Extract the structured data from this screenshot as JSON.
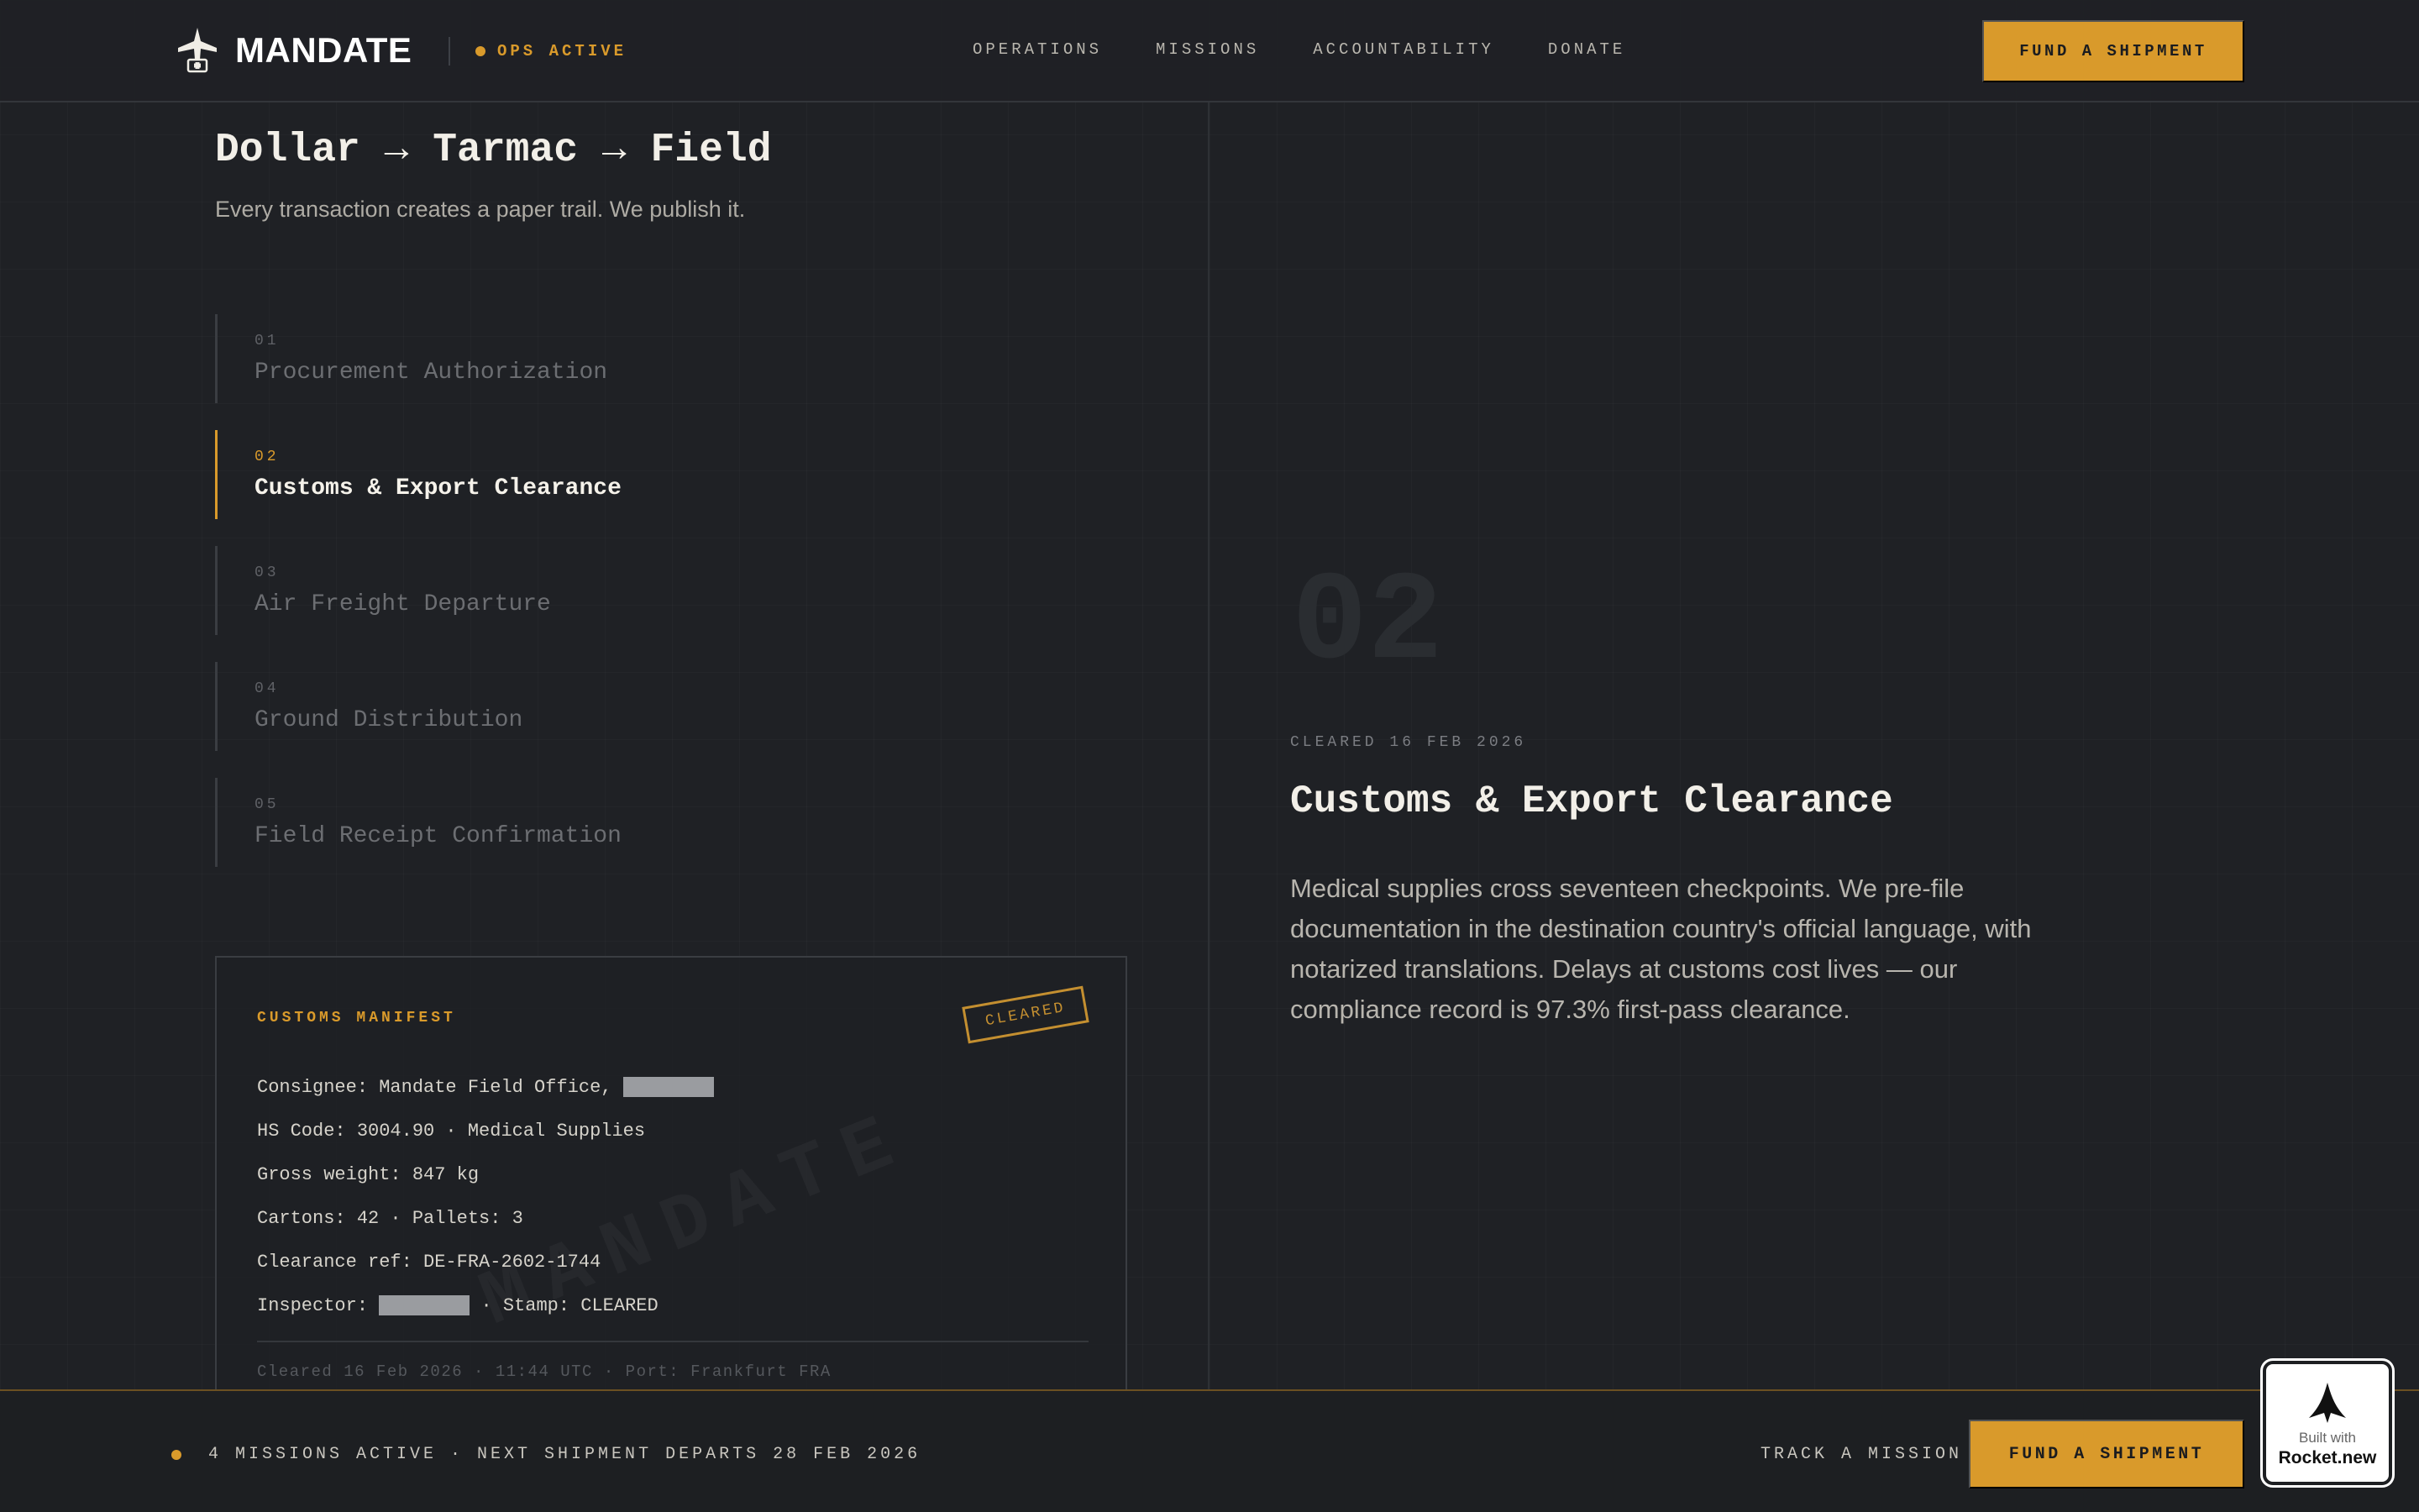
{
  "header": {
    "brand": "MANDATE",
    "ops_status": "OPS ACTIVE",
    "nav": [
      "OPERATIONS",
      "MISSIONS",
      "ACCOUNTABILITY",
      "DONATE"
    ],
    "cta": "FUND A SHIPMENT"
  },
  "intro": {
    "title": "Dollar → Tarmac → Field",
    "subtitle": "Every transaction creates a paper trail. We publish it."
  },
  "steps": [
    {
      "num": "01",
      "label": "Procurement Authorization"
    },
    {
      "num": "02",
      "label": "Customs & Export Clearance"
    },
    {
      "num": "03",
      "label": "Air Freight Departure"
    },
    {
      "num": "04",
      "label": "Ground Distribution"
    },
    {
      "num": "05",
      "label": "Field Receipt Confirmation"
    }
  ],
  "active_step": "02",
  "manifest": {
    "title": "CUSTOMS MANIFEST",
    "stamp": "CLEARED",
    "watermark": "MANDATE",
    "consignee": "Consignee: Mandate Field Office,",
    "hs_code": "HS Code: 3004.90 · Medical Supplies",
    "gross_weight": "Gross weight: 847 kg",
    "cartons": "Cartons: 42 · Pallets: 3",
    "clearance_ref": "Clearance ref: DE-FRA-2602-1744",
    "inspector": "Inspector:",
    "stamp_text": "· Stamp: CLEARED",
    "footer": "Cleared 16 Feb 2026 · 11:44 UTC · Port: Frankfurt FRA"
  },
  "detail": {
    "big_number": "02",
    "date": "CLEARED 16 FEB 2026",
    "title": "Customs & Export Clearance",
    "body": "Medical supplies cross seventeen checkpoints. We pre-file documentation in the destination country's official language, with notarized translations. Delays at customs cost lives — our compliance record is 97.3% first-pass clearance."
  },
  "bottom": {
    "status": "4 MISSIONS ACTIVE · NEXT SHIPMENT DEPARTS 28 FEB 2026",
    "track": "TRACK A MISSION",
    "cta": "FUND A SHIPMENT"
  },
  "badge": {
    "line1": "Built with",
    "line2": "Rocket.new"
  },
  "colors": {
    "accent": "#d99a2b",
    "background": "#1f2125"
  }
}
